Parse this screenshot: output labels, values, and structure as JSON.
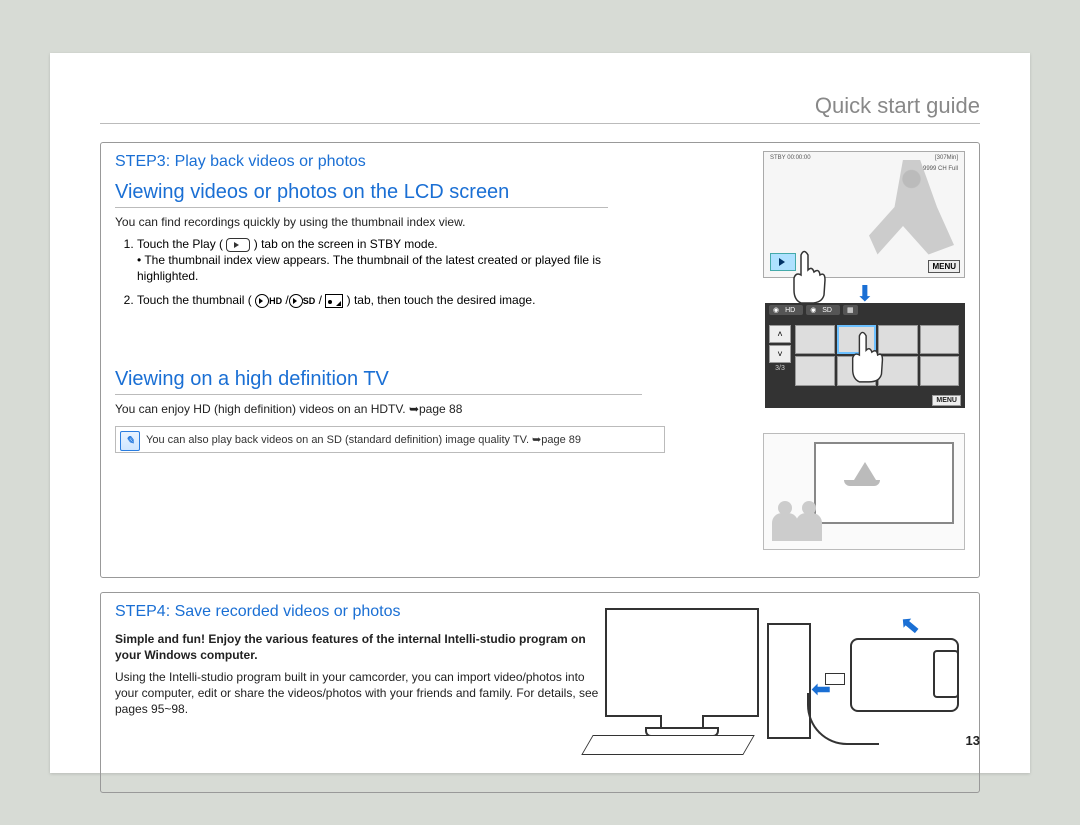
{
  "header": {
    "title": "Quick start guide"
  },
  "panel1": {
    "step_title": "STEP3: Play back videos or photos",
    "section1_title": "Viewing videos or photos on the LCD screen",
    "section1_intro": "You can find recordings quickly by using the thumbnail index view.",
    "section1_li1a": "Touch the Play (",
    "section1_li1b": ") tab on the screen in STBY mode.",
    "section1_li1_sub": "The thumbnail index view appears. The thumbnail of the latest created or played file is highlighted.",
    "section1_li2a": "Touch the thumbnail (",
    "section1_li2_hd": "HD",
    "section1_li2_sd": "SD",
    "section1_li2b": ") tab, then touch the desired image.",
    "section2_title": "Viewing on a high definition TV",
    "section2_body": "You can enjoy HD (high definition) videos on an HDTV. ➥page 88",
    "note": "You can also play back videos on an SD (standard definition) image quality TV. ➥page 89",
    "lcd1_top_left": "STBY  00:00:00",
    "lcd1_top_right": "[307Min]",
    "lcd1_line2": "9999  CH   Full",
    "lcd1_menu": "MENU",
    "lcd2_tab_hd": "HD",
    "lcd2_tab_sd": "SD",
    "lcd2_page": "3/3",
    "lcd2_menu": "MENU"
  },
  "panel2": {
    "step_title": "STEP4: Save recorded videos or photos",
    "bold_intro": "Simple and fun! Enjoy the various features of the internal Intelli-studio program on your Windows computer.",
    "body": "Using the Intelli-studio program built in your camcorder, you can import video/photos into your computer, edit or share the videos/photos with your friends and family. For details, see pages 95~98."
  },
  "page_number": "13"
}
